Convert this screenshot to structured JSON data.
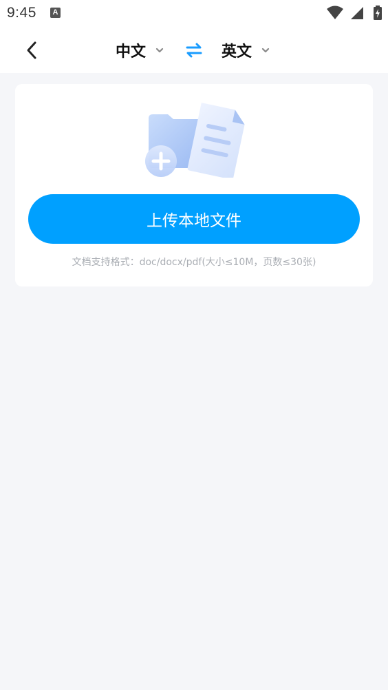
{
  "status_bar": {
    "time": "9:45",
    "notification_icon": "A",
    "icons": [
      "wifi-icon",
      "signal-icon",
      "battery-charging-icon"
    ]
  },
  "nav": {
    "back_icon": "chevron-left-icon",
    "source_language": "中文",
    "target_language": "英文",
    "swap_icon": "swap-arrows-icon",
    "swap_color": "#1a9cff"
  },
  "upload": {
    "illustration_icon": "folder-document-add-icon",
    "button_label": "上传本地文件",
    "button_color": "#00a0ff",
    "format_hint": "文档支持格式：doc/docx/pdf(大小≤10M，页数≤30张)"
  }
}
